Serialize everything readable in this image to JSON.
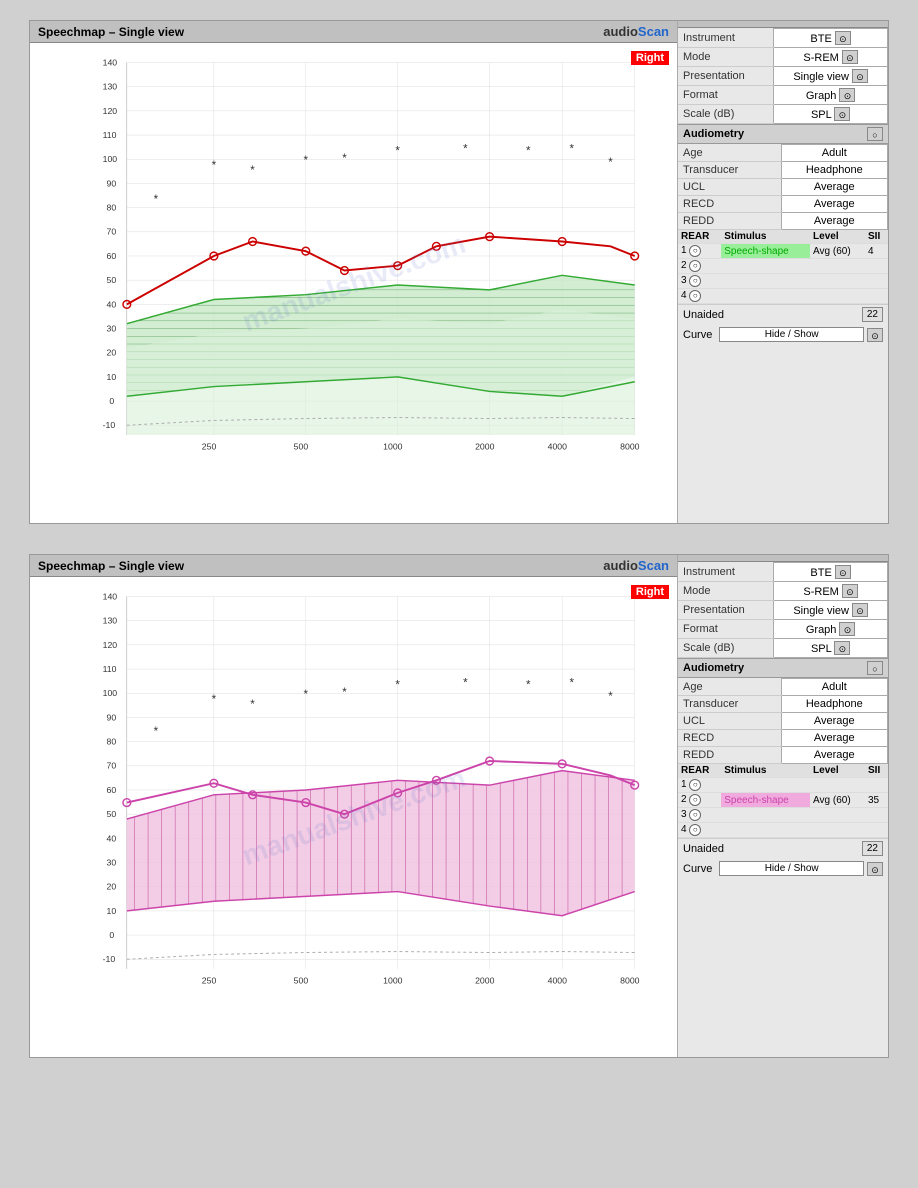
{
  "panel1": {
    "title": "Speechmap – Single view",
    "logo": "audioScan",
    "right_badge": "Right",
    "instrument": {
      "label": "Instrument",
      "value": "BTE"
    },
    "mode": {
      "label": "Mode",
      "value": "S-REM"
    },
    "presentation": {
      "label": "Presentation",
      "value": "Single view"
    },
    "format": {
      "label": "Format",
      "value": "Graph"
    },
    "scale": {
      "label": "Scale (dB)",
      "value": "SPL"
    },
    "audiometry_label": "Audiometry",
    "age": {
      "label": "Age",
      "value": "Adult"
    },
    "transducer": {
      "label": "Transducer",
      "value": "Headphone"
    },
    "ucl": {
      "label": "UCL",
      "value": "Average"
    },
    "recd": {
      "label": "RECD",
      "value": "Average"
    },
    "redd": {
      "label": "REDD",
      "value": "Average"
    },
    "rear_header": {
      "rear": "REAR",
      "stimulus": "Stimulus",
      "level": "Level",
      "sii": "SII"
    },
    "rows": [
      {
        "num": "1",
        "filled": true,
        "color": "green",
        "stimulus": "Speech-shape",
        "level": "Avg (60)",
        "sii": "4"
      },
      {
        "num": "2",
        "filled": false,
        "color": "",
        "stimulus": "",
        "level": "",
        "sii": ""
      },
      {
        "num": "3",
        "filled": false,
        "color": "",
        "stimulus": "",
        "level": "",
        "sii": ""
      },
      {
        "num": "4",
        "filled": false,
        "color": "",
        "stimulus": "",
        "level": "",
        "sii": ""
      }
    ],
    "unaided_label": "Unaided",
    "unaided_value": "22",
    "curve_label": "Curve",
    "hide_show": "Hide / Show",
    "chart_color": "green",
    "y_labels": [
      "140",
      "130",
      "120",
      "110",
      "100",
      "90",
      "80",
      "70",
      "60",
      "50",
      "40",
      "30",
      "20",
      "10",
      "0",
      "-10"
    ],
    "x_labels": [
      "250",
      "500",
      "1000",
      "2000",
      "4000",
      "8000"
    ]
  },
  "panel2": {
    "title": "Speechmap – Single view",
    "logo": "audioScan",
    "right_badge": "Right",
    "instrument": {
      "label": "Instrument",
      "value": "BTE"
    },
    "mode": {
      "label": "Mode",
      "value": "S-REM"
    },
    "presentation": {
      "label": "Presentation",
      "value": "Single view"
    },
    "format": {
      "label": "Format",
      "value": "Graph"
    },
    "scale": {
      "label": "Scale (dB)",
      "value": "SPL"
    },
    "audiometry_label": "Audiometry",
    "age": {
      "label": "Age",
      "value": "Adult"
    },
    "transducer": {
      "label": "Transducer",
      "value": "Headphone"
    },
    "ucl": {
      "label": "UCL",
      "value": "Average"
    },
    "recd": {
      "label": "RECD",
      "value": "Average"
    },
    "redd": {
      "label": "REDD",
      "value": "Average"
    },
    "rear_header": {
      "rear": "REAR",
      "stimulus": "Stimulus",
      "level": "Level",
      "sii": "SII"
    },
    "rows": [
      {
        "num": "1",
        "filled": false,
        "color": "",
        "stimulus": "",
        "level": "",
        "sii": ""
      },
      {
        "num": "2",
        "filled": true,
        "color": "pink",
        "stimulus": "Speech-shape",
        "level": "Avg (60)",
        "sii": "35"
      },
      {
        "num": "3",
        "filled": false,
        "color": "",
        "stimulus": "",
        "level": "",
        "sii": ""
      },
      {
        "num": "4",
        "filled": false,
        "color": "",
        "stimulus": "",
        "level": "",
        "sii": ""
      }
    ],
    "unaided_label": "Unaided",
    "unaided_value": "22",
    "curve_label": "Curve",
    "hide_show": "Hide / Show",
    "chart_color": "pink",
    "y_labels": [
      "140",
      "130",
      "120",
      "110",
      "100",
      "90",
      "80",
      "70",
      "60",
      "50",
      "40",
      "30",
      "20",
      "10",
      "0",
      "-10"
    ],
    "x_labels": [
      "250",
      "500",
      "1000",
      "2000",
      "4000",
      "8000"
    ]
  },
  "watermark": "manualshive.com"
}
